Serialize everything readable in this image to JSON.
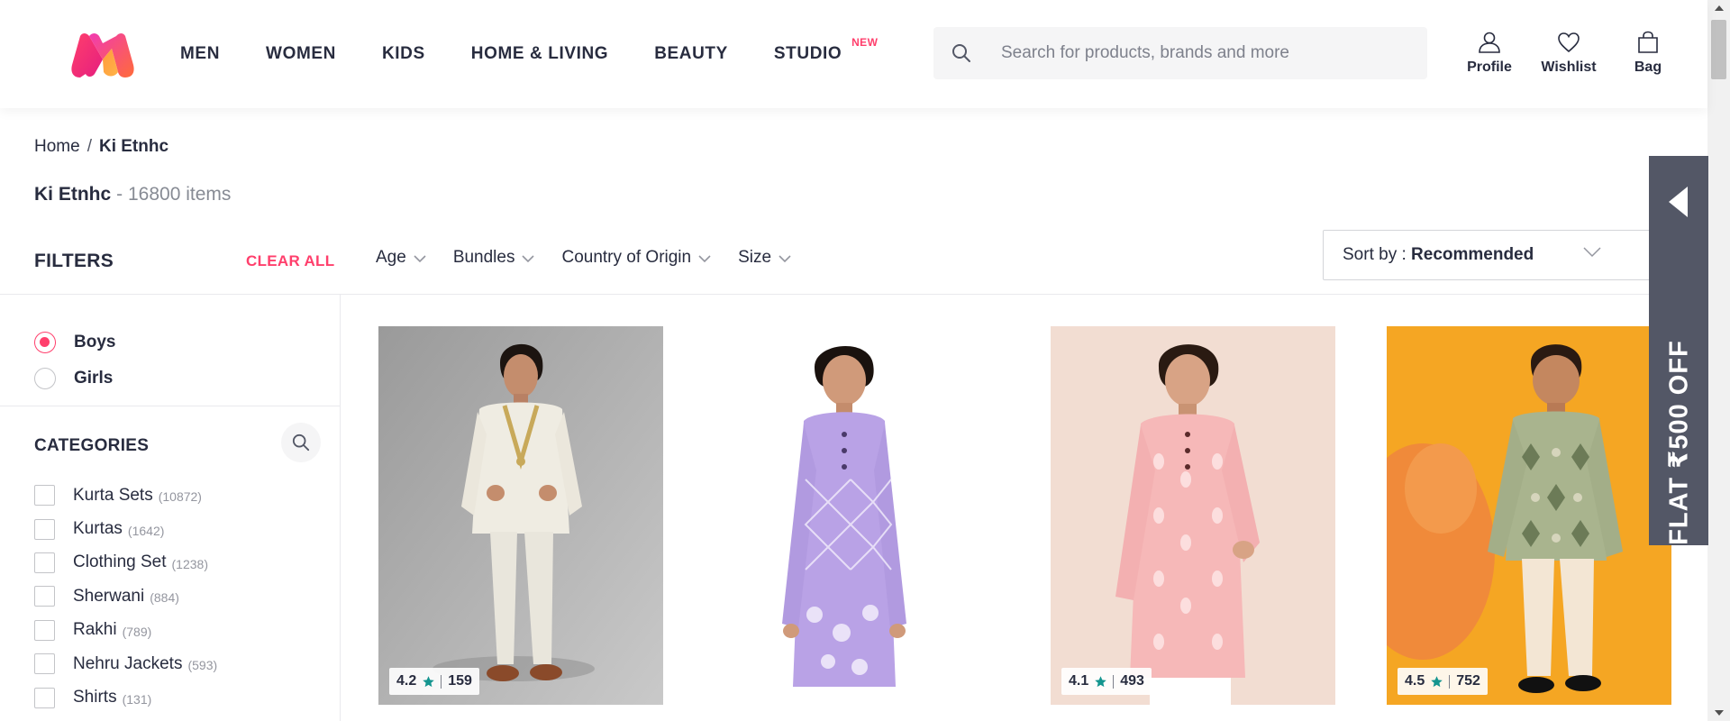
{
  "header": {
    "nav": [
      "MEN",
      "WOMEN",
      "KIDS",
      "HOME & LIVING",
      "BEAUTY",
      "STUDIO"
    ],
    "new_tag": "NEW",
    "search_placeholder": "Search for products, brands and more",
    "actions": {
      "profile": "Profile",
      "wishlist": "Wishlist",
      "bag": "Bag"
    }
  },
  "breadcrumb": {
    "home": "Home",
    "separator": "/",
    "current": "Ki Etnhc"
  },
  "title": {
    "name": "Ki Etnhc",
    "count": "- 16800 items"
  },
  "filters": {
    "title": "FILTERS",
    "clear_all": "CLEAR ALL",
    "facets": [
      "Age",
      "Bundles",
      "Country of Origin",
      "Size"
    ],
    "gender": [
      {
        "label": "Boys",
        "checked": true
      },
      {
        "label": "Girls",
        "checked": false
      }
    ],
    "categories_title": "CATEGORIES",
    "categories": [
      {
        "label": "Kurta Sets",
        "count": "(10872)"
      },
      {
        "label": "Kurtas",
        "count": "(1642)"
      },
      {
        "label": "Clothing Set",
        "count": "(1238)"
      },
      {
        "label": "Sherwani",
        "count": "(884)"
      },
      {
        "label": "Rakhi",
        "count": "(789)"
      },
      {
        "label": "Nehru Jackets",
        "count": "(593)"
      },
      {
        "label": "Shirts",
        "count": "(131)"
      }
    ]
  },
  "sort": {
    "prefix": "Sort by : ",
    "value": "Recommended"
  },
  "products": [
    {
      "rating": "4.2",
      "reviews": "159",
      "show_rating": true
    },
    {
      "rating": "",
      "reviews": "",
      "show_rating": false
    },
    {
      "rating": "4.1",
      "reviews": "493",
      "show_rating": true
    },
    {
      "rating": "4.5",
      "reviews": "752",
      "show_rating": true
    }
  ],
  "offer": {
    "text": "FLAT ₹500 OFF"
  },
  "colors": {
    "accent": "#ff3f6c",
    "text": "#282c3f",
    "rating_star": "#14958f",
    "offer_bg": "#535766"
  }
}
